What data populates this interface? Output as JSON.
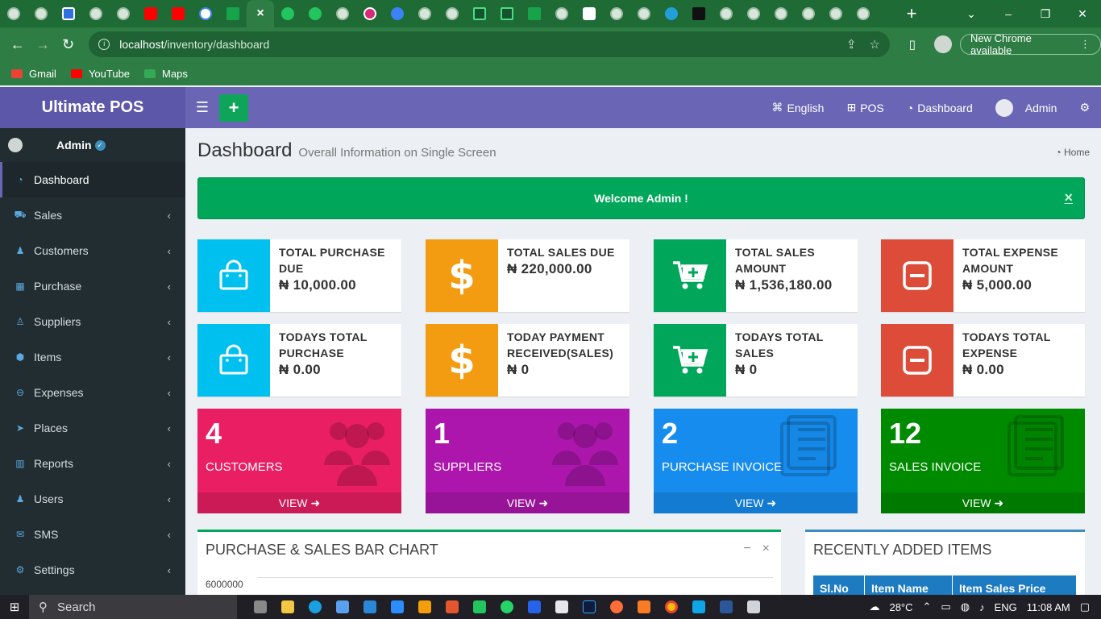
{
  "browser": {
    "url_host": "localhost",
    "url_path": "/inventory/dashboard",
    "update_label": "New Chrome available",
    "bookmarks": [
      {
        "label": "Gmail",
        "color": "#ea4335"
      },
      {
        "label": "YouTube",
        "color": "#ff0000"
      },
      {
        "label": "Maps",
        "color": "#34a853"
      }
    ]
  },
  "app": {
    "brand": "Ultimate POS",
    "topnav": {
      "language": "English",
      "pos": "POS",
      "dashboard": "Dashboard",
      "user": "Admin"
    },
    "sidebar": {
      "user": "Admin",
      "items": [
        {
          "label": "Dashboard",
          "icon": "dashboard-icon",
          "active": true
        },
        {
          "label": "Sales",
          "icon": "cart-icon"
        },
        {
          "label": "Customers",
          "icon": "users-icon"
        },
        {
          "label": "Purchase",
          "icon": "grid-icon"
        },
        {
          "label": "Suppliers",
          "icon": "user-plus-icon"
        },
        {
          "label": "Items",
          "icon": "cubes-icon"
        },
        {
          "label": "Expenses",
          "icon": "minus-circle-icon"
        },
        {
          "label": "Places",
          "icon": "paper-plane-icon"
        },
        {
          "label": "Reports",
          "icon": "bar-chart-icon"
        },
        {
          "label": "Users",
          "icon": "users-icon"
        },
        {
          "label": "SMS",
          "icon": "envelope-icon"
        },
        {
          "label": "Settings",
          "icon": "cogs-icon"
        }
      ]
    },
    "page": {
      "title": "Dashboard",
      "subtitle": "Overall Information on Single Screen",
      "breadcrumb": "Home",
      "alert": "Welcome Admin !",
      "alert_close": "×"
    },
    "infoboxes": [
      {
        "label": "TOTAL PURCHASE DUE",
        "value": "₦ 10,000.00",
        "color": "#00c0ef",
        "icon": "shopping-bag-icon"
      },
      {
        "label": "TOTAL SALES DUE",
        "value": "₦ 220,000.00",
        "color": "#f39c12",
        "icon": "dollar-icon"
      },
      {
        "label": "TOTAL SALES AMOUNT",
        "value": "₦ 1,536,180.00",
        "color": "#00a65a",
        "icon": "cart-plus-icon"
      },
      {
        "label": "TOTAL EXPENSE AMOUNT",
        "value": "₦ 5,000.00",
        "color": "#dd4b39",
        "icon": "minus-square-icon"
      },
      {
        "label": "TODAYS TOTAL PURCHASE",
        "value": "₦ 0.00",
        "color": "#00c0ef",
        "icon": "shopping-bag-icon"
      },
      {
        "label": "TODAY PAYMENT RECEIVED(SALES)",
        "value": "₦ 0",
        "color": "#f39c12",
        "icon": "dollar-icon"
      },
      {
        "label": "TODAYS TOTAL SALES",
        "value": "₦ 0",
        "color": "#00a65a",
        "icon": "cart-plus-icon"
      },
      {
        "label": "TODAYS TOTAL EXPENSE",
        "value": "₦ 0.00",
        "color": "#dd4b39",
        "icon": "minus-square-icon"
      }
    ],
    "smallboxes": [
      {
        "count": "4",
        "label": "CUSTOMERS",
        "link": "VIEW",
        "color": "#e91e63",
        "icon": "users-icon"
      },
      {
        "count": "1",
        "label": "SUPPLIERS",
        "link": "VIEW",
        "color": "#ac16ac",
        "icon": "users-icon"
      },
      {
        "count": "2",
        "label": "PURCHASE INVOICE",
        "link": "VIEW",
        "color": "#168dee",
        "icon": "file-icon"
      },
      {
        "count": "12",
        "label": "SALES INVOICE",
        "link": "VIEW",
        "color": "#008a00",
        "icon": "file-icon"
      }
    ],
    "chart_panel": {
      "title": "PURCHASE & SALES BAR CHART",
      "y_top_tick": "6000000"
    },
    "items_panel": {
      "title": "RECENTLY ADDED ITEMS",
      "columns": [
        "Sl.No",
        "Item Name",
        "Item Sales Price"
      ]
    }
  },
  "taskbar": {
    "search": "Search",
    "weather": "28°C",
    "lang": "ENG",
    "time": "11:08 AM"
  }
}
